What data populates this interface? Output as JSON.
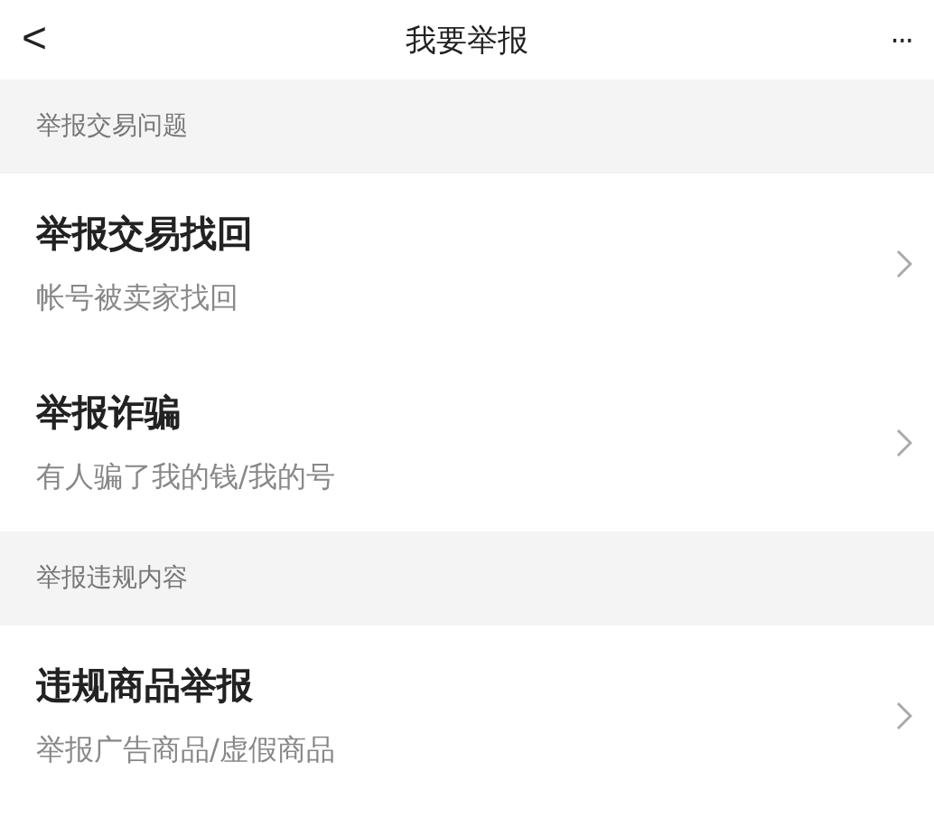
{
  "header": {
    "back": "<",
    "title": "我要举报",
    "more": "···"
  },
  "sections": [
    {
      "title": "举报交易问题",
      "items": [
        {
          "title": "举报交易找回",
          "subtitle": "帐号被卖家找回"
        },
        {
          "title": "举报诈骗",
          "subtitle": "有人骗了我的钱/我的号"
        }
      ]
    },
    {
      "title": "举报违规内容",
      "items": [
        {
          "title": "违规商品举报",
          "subtitle": "举报广告商品/虚假商品"
        }
      ]
    }
  ]
}
